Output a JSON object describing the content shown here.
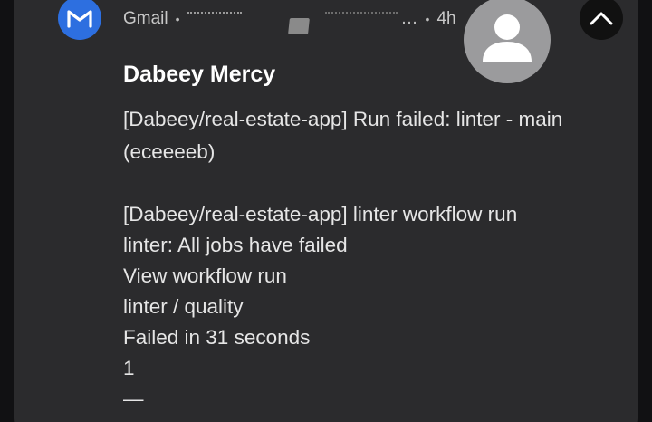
{
  "notification": {
    "app_name": "Gmail",
    "separator": "•",
    "redacted_tail": "…",
    "time": "4h",
    "app_icon": "gmail-m-icon",
    "avatar_icon": "person-icon",
    "collapse_icon": "chevron-up-icon",
    "colors": {
      "card_bg": "#2b2b2d",
      "app_icon_bg": "#2d6fe0",
      "avatar_bg": "#9b9b9d",
      "text": "#e6e6e6"
    }
  },
  "email": {
    "sender": "Dabeey Mercy",
    "subject": "[Dabeey/real-estate-app] Run failed: linter - main (eceeeeb)",
    "body": [
      "[Dabeey/real-estate-app] linter workflow run",
      "linter: All jobs have failed",
      "View workflow run",
      "linter / quality",
      "Failed in 31 seconds",
      "1",
      "—"
    ]
  }
}
